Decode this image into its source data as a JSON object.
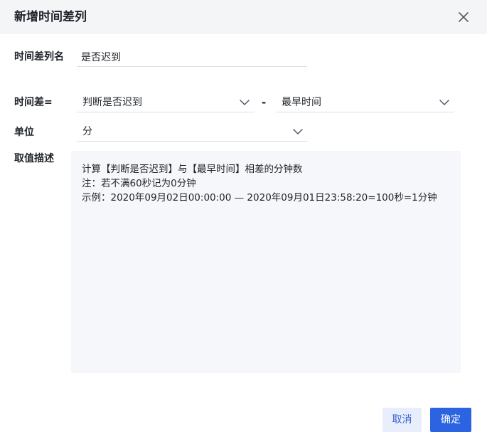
{
  "dialog": {
    "title": "新增时间差列",
    "close_icon": "close-icon"
  },
  "form": {
    "column_name": {
      "label": "时间差列名",
      "value": "是否迟到"
    },
    "time_diff": {
      "label": "时间差=",
      "left_select": "判断是否迟到",
      "operator": "-",
      "right_select": "最早时间"
    },
    "unit": {
      "label": "单位",
      "value": "分"
    },
    "description": {
      "label": "取值描述",
      "lines": [
        "计算【判断是否迟到】与【最早时间】相差的分钟数",
        "注：若不满60秒记为0分钟",
        "示例：2020年09月02日00:00:00 — 2020年09月01日23:58:20=100秒=1分钟"
      ]
    }
  },
  "footer": {
    "cancel_label": "取消",
    "confirm_label": "确定"
  },
  "colors": {
    "primary": "#2b63e0",
    "cancel_bg": "#e8eefc",
    "header_bg": "#f4f5f7",
    "desc_bg": "#f6f7fa"
  }
}
